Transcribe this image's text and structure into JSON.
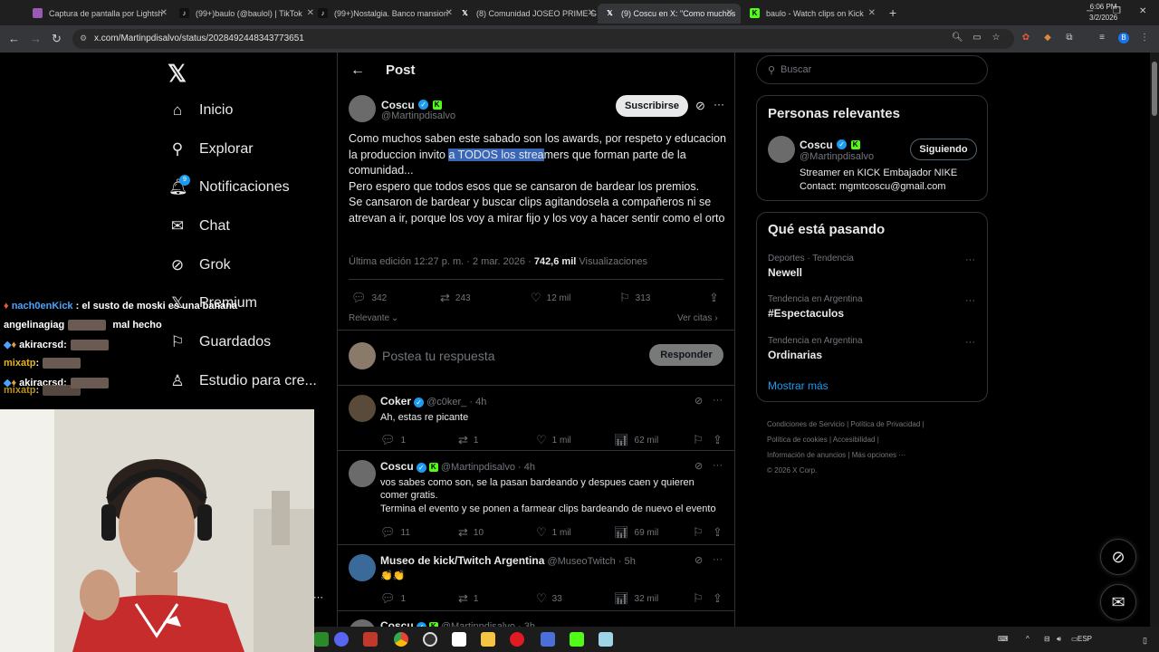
{
  "browser": {
    "tabs": [
      {
        "title": "Captura de pantalla por Lightsh",
        "icon_color": "#9b59b6"
      },
      {
        "title": "(99+)baulo (@baulol) | TikTok",
        "icon_color": "#000000"
      },
      {
        "title": "(99+)Nostalgia. Banco mansion",
        "icon_color": "#000000"
      },
      {
        "title": "(8) Comunidad JOSEO PRIME G",
        "icon_color": "#000000"
      },
      {
        "title": "(9) Coscu en X: \"Como muchos",
        "icon_color": "#000000"
      },
      {
        "title": "baulo - Watch clips on Kick",
        "icon_color": "#53fc18"
      }
    ],
    "new_tab": "+",
    "url": "x.com/Martinpdisalvo/status/2028492448343773651",
    "profile_initial": "B"
  },
  "nav": {
    "items": [
      {
        "label": "Inicio",
        "icon": "home-icon"
      },
      {
        "label": "Explorar",
        "icon": "search-icon"
      },
      {
        "label": "Notificaciones",
        "icon": "bell-icon",
        "badge": "9"
      },
      {
        "label": "Chat",
        "icon": "mail-icon"
      },
      {
        "label": "Grok",
        "icon": "grok-icon"
      },
      {
        "label": "Premium",
        "icon": "x-icon"
      },
      {
        "label": "Guardados",
        "icon": "bookmark-icon"
      },
      {
        "label": "Estudio para cre...",
        "icon": "studio-icon"
      }
    ]
  },
  "header": {
    "title": "Post"
  },
  "post": {
    "author": "Coscu",
    "handle": "@Martinpdisalvo",
    "subscribe_label": "Suscribirse",
    "text_before": "Como muchos saben este sabado son los awards, por respeto y educacion la produccion invito ",
    "text_highlight": "a TODOS los strea",
    "text_after": "mers que forman parte de la comunidad...",
    "text_p2": "Pero espero que todos esos que se cansaron de bardear los premios.",
    "text_p3": "Se cansaron de bardear y buscar clips agitandosela a compañeros ni se atrevan a ir, porque los voy a mirar fijo y los voy a hacer sentir como el orto",
    "edited": "Última edición 12:27 p. m. · 2 mar. 2026 ·",
    "views": "742,6 mil",
    "views_label": "Visualizaciones",
    "stats": {
      "replies": "342",
      "reposts": "243",
      "likes": "12 mil",
      "bookmarks": "313"
    },
    "sort_label": "Relevante",
    "quotes_label": "Ver citas"
  },
  "composer": {
    "placeholder": "Postea tu respuesta",
    "button": "Responder"
  },
  "replies": [
    {
      "name": "Coker",
      "handle": "@c0ker_",
      "time": "· 4h",
      "text": "Ah, estas re picante",
      "replies": "1",
      "reposts": "1",
      "likes": "1 mil",
      "views": "62 mil"
    },
    {
      "name": "Coscu",
      "handle": "@Martinpdisalvo",
      "time": "· 4h",
      "text": "vos sabes como son, se la pasan bardeando y despues caen y quieren comer gratis.",
      "text2": "Termina el evento y se ponen a farmear clips bardeando de nuevo el evento",
      "replies": "11",
      "reposts": "10",
      "likes": "1 mil",
      "views": "69 mil"
    },
    {
      "name": "Museo de kick/Twitch Argentina",
      "handle": "@MuseoTwitch",
      "time": "· 5h",
      "text": "👏👏",
      "replies": "1",
      "reposts": "1",
      "likes": "33",
      "views": "32 mil"
    },
    {
      "name": "Coscu",
      "handle": "@Martinpdisalvo",
      "time": "· 3h"
    }
  ],
  "sidebar": {
    "search_placeholder": "Buscar",
    "relevant_title": "Personas relevantes",
    "person": {
      "name": "Coscu",
      "handle": "@Martinpdisalvo",
      "follow_label": "Siguiendo",
      "bio1": "Streamer en KICK Embajador NIKE",
      "bio2": "Contact: mgmtcoscu@gmail.com"
    },
    "trending_title": "Qué está pasando",
    "trends": [
      {
        "category": "Deportes · Tendencia",
        "name": "Newell"
      },
      {
        "category": "Tendencia en Argentina",
        "name": "#Espectaculos"
      },
      {
        "category": "Tendencia en Argentina",
        "name": "Ordinarias"
      }
    ],
    "show_more": "Mostrar más",
    "footer": [
      "Condiciones de Servicio",
      "Política de Privacidad",
      "Política de cookies",
      "Accesibilidad",
      "Información de anuncios",
      "Más opciones ···",
      "© 2026 X Corp."
    ]
  },
  "chat": [
    {
      "user": "nach0enKick",
      "user_color": "#4aa3ff",
      "msg": ": el susto de moski es una banana"
    },
    {
      "user": "angelinagiag",
      "user_color": "#ffffff",
      "msg": "mal hecho"
    },
    {
      "user": "akiracrsd",
      "user_color": "#ffffff",
      "msg": ":"
    },
    {
      "user": "mixatp",
      "user_color": "#e6b422",
      "msg": ":"
    },
    {
      "user": "akiracrsd",
      "user_color": "#ffffff",
      "msg": ":"
    },
    {
      "user": "mixatp",
      "user_color": "#e6b422",
      "msg": ":"
    }
  ],
  "taskbar": {
    "lang": "ESP",
    "time": "6:06 PM",
    "date": "3/2/2026"
  },
  "colors": {
    "accent": "#1d9bf0",
    "kick": "#53fc18",
    "highlight": "#3a66b8"
  }
}
